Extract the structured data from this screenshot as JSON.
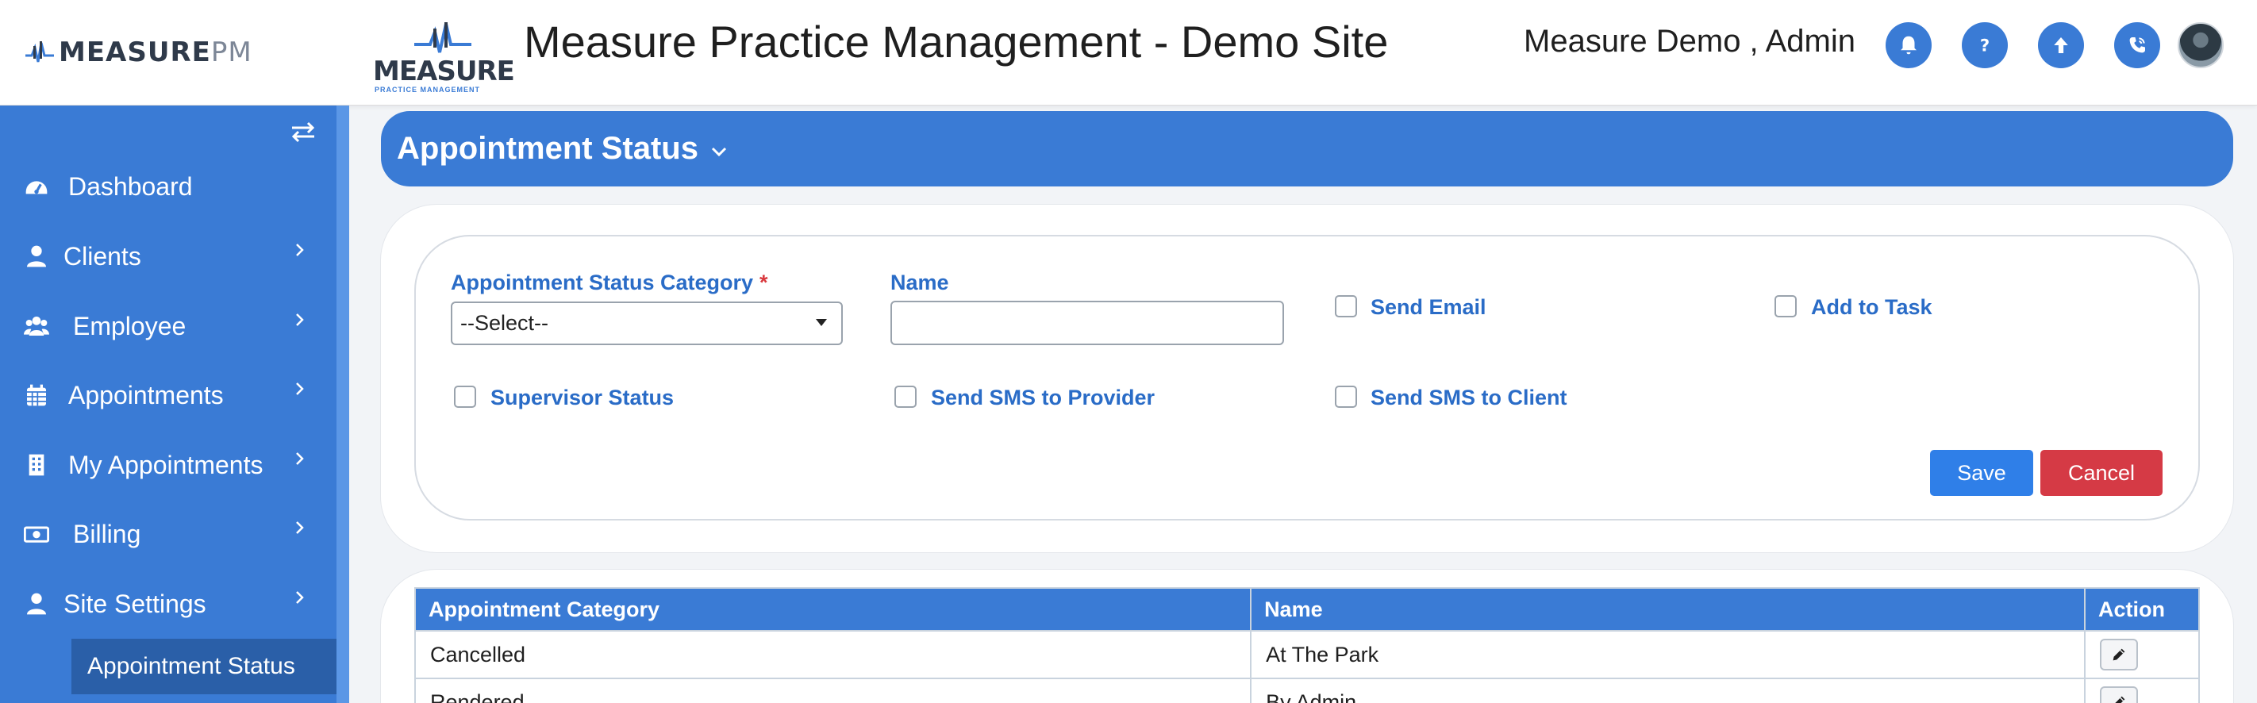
{
  "header": {
    "brand_primary": "MEASURE",
    "brand_secondary": "PM",
    "logo_word": "MEASURE",
    "logo_tagline": "PRACTICE MANAGEMENT",
    "app_title": "Measure Practice Management - Demo Site",
    "user_name": "Measure Demo , Admin",
    "actions": [
      {
        "icon": "bell-icon"
      },
      {
        "icon": "help-icon",
        "glyph": "?"
      },
      {
        "icon": "upload-arrow-icon"
      },
      {
        "icon": "phone-icon"
      }
    ]
  },
  "sidebar": {
    "items": [
      {
        "label": "Dashboard",
        "icon": "dashboard-icon"
      },
      {
        "label": "Clients",
        "icon": "user-icon"
      },
      {
        "label": "Employee",
        "icon": "users-icon"
      },
      {
        "label": "Appointments",
        "icon": "calendar-icon"
      },
      {
        "label": "My Appointments",
        "icon": "building-icon"
      },
      {
        "label": "Billing",
        "icon": "money-icon"
      },
      {
        "label": "Site Settings",
        "icon": "user-icon"
      }
    ],
    "active_subitem": "Appointment Status"
  },
  "page": {
    "title": "Appointment Status"
  },
  "form": {
    "category_label": "Appointment Status Category",
    "required_marker": "*",
    "category_value": "--Select--",
    "name_label": "Name",
    "name_value": "",
    "send_email_label": "Send Email",
    "add_to_task_label": "Add to Task",
    "supervisor_status_label": "Supervisor Status",
    "send_sms_provider_label": "Send SMS to Provider",
    "send_sms_client_label": "Send SMS to Client",
    "save_label": "Save",
    "cancel_label": "Cancel"
  },
  "table": {
    "columns": [
      "Appointment Category",
      "Name",
      "Action"
    ],
    "rows": [
      {
        "category": "Cancelled",
        "name": "At The Park"
      },
      {
        "category": "Rendered",
        "name": "By Admin"
      }
    ]
  },
  "colors": {
    "primary": "#3a7bd5",
    "save": "#2f7fe8",
    "cancel": "#d53a45",
    "label": "#2a6cc7"
  }
}
